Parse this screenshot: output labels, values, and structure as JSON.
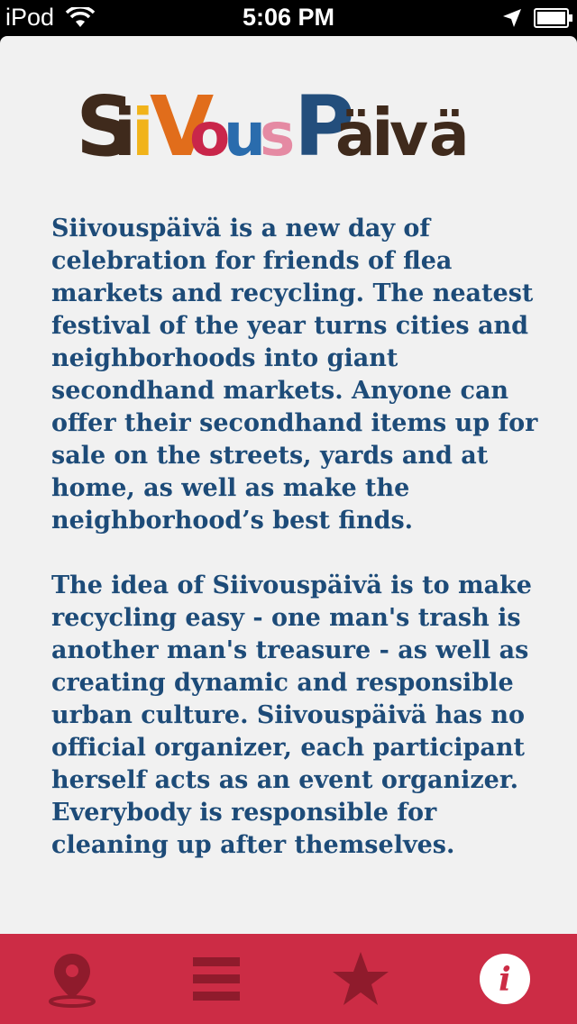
{
  "status_bar": {
    "carrier": "iPod",
    "time": "5:06 PM"
  },
  "logo": {
    "text": "SiivousPäivä",
    "letters": [
      "S",
      "i",
      "i",
      "V",
      "o",
      "u",
      "s",
      "P",
      "ä",
      "i",
      "v",
      "ä"
    ],
    "colors": [
      "#3f2a1c",
      "#3f2a1c",
      "#f1b31a",
      "#e16d1b",
      "#c9264a",
      "#2a6cad",
      "#e58aa3",
      "#234e7c",
      "#3f2a1c",
      "#3f2a1c",
      "#3f2a1c",
      "#3f2a1c"
    ]
  },
  "content": {
    "paragraphs": [
      "Siivouspäivä is a new day of celebration for friends of flea markets and recycling. The neatest festival of the year turns cities and neighborhoods into giant secondhand markets. Anyone can offer their secondhand items up for sale on the streets, yards and at home, as well as make the neighborhood’s best finds.",
      "The idea of Siivouspäivä is to make recycling easy - one man's trash is another man's treasure - as well as creating dynamic and responsible urban culture. Siivouspäivä has no official organizer, each participant herself acts as an event organizer. Everybody is responsible for cleaning up after themselves."
    ]
  },
  "tabbar": {
    "tabs": [
      {
        "icon": "map-pin-icon"
      },
      {
        "icon": "list-icon"
      },
      {
        "icon": "star-icon"
      },
      {
        "icon": "info-icon",
        "active": true
      }
    ],
    "background": "#cc2c45",
    "icon_color": "#8f1b2c"
  },
  "colors": {
    "text": "#1d4b78",
    "page_background": "#f1f1f1"
  }
}
